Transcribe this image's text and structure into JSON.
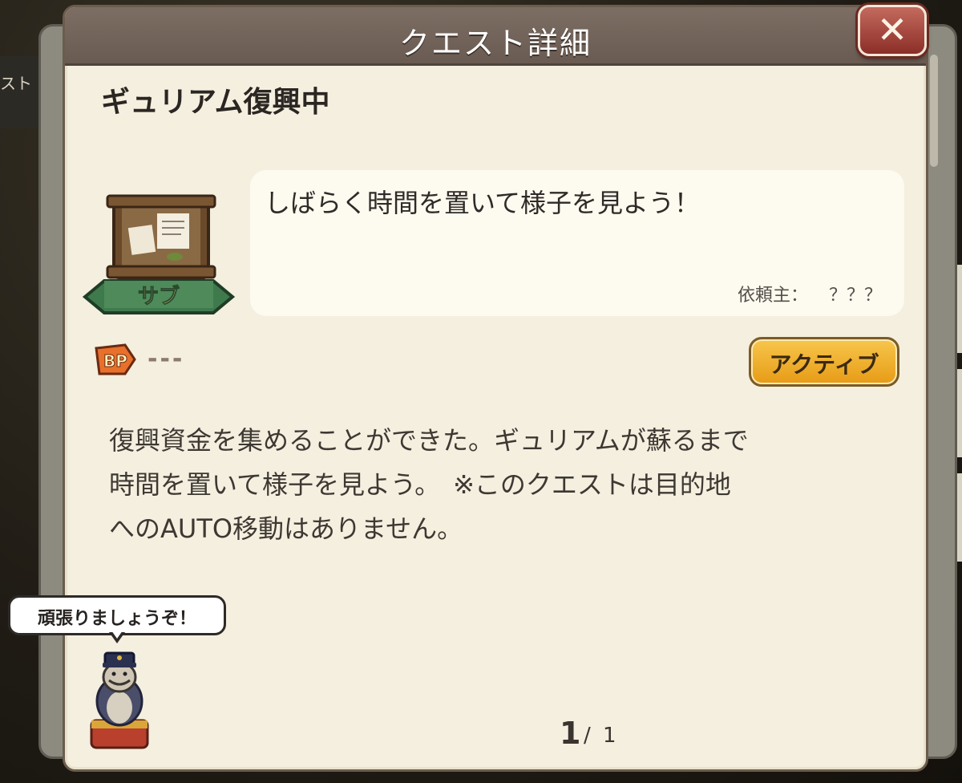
{
  "dialog": {
    "title": "クエスト詳細",
    "close_icon": "close-icon"
  },
  "background": {
    "left_tab_text": "スト"
  },
  "quest": {
    "name": "ギュリアム復興中",
    "category_label": "サブ",
    "message": "しばらく時間を置いて様子を見よう！",
    "client_label": "依頼主：",
    "client_value": "？？？",
    "bp_icon_text": "BP",
    "bp_value": "---",
    "status": "アクティブ",
    "description_lines": [
      "復興資金を集めることができた。ギュリアムが蘇るまで",
      "時間を置いて様子を見よう。　※このクエストは目的地",
      "へのAUTO移動はありません。"
    ]
  },
  "assistant": {
    "speech": "頑張りましょうぞ！"
  },
  "pagination": {
    "current": "1",
    "separator": "/",
    "total": "1"
  },
  "colors": {
    "panel_bg": "#f4efdf",
    "title_bar": "#7d6e64",
    "close_button": "#a5443b",
    "status_badge": "#f2b531",
    "banner_green": "#4f8a5a"
  }
}
